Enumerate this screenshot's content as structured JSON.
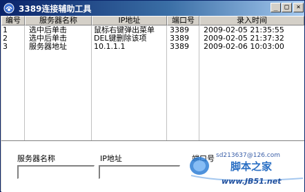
{
  "window": {
    "title": "3389连接辅助工具",
    "buttons": {
      "minimize": "_",
      "maximize": "□",
      "close": "×"
    }
  },
  "table": {
    "headers": [
      "编号",
      "服务器名称",
      "IP地址",
      "端口号",
      "录入时间"
    ],
    "rows": [
      [
        "1",
        "选中后单击",
        "鼠标右键弹出菜单",
        "3389",
        "2009-02-05 21:35:55"
      ],
      [
        "2",
        "选中后单击",
        "DEL键删除该项",
        "3389",
        "2009-02-05 21:37:32"
      ],
      [
        "3",
        "服务器地址",
        "10.1.1.1",
        "3389",
        "2009-02-06 10:03:00"
      ]
    ]
  },
  "form": {
    "server_name_label": "服务器名称",
    "ip_label": "IP地址",
    "port_label": "端口号",
    "server_name_value": "",
    "ip_value": ""
  },
  "watermark": {
    "email": "sd213637@126.com",
    "name": "脚本之家",
    "url": "www.JB51.net"
  },
  "colors": {
    "titlebar_start": "#0a246a",
    "titlebar_end": "#a6caf0",
    "window_face": "#d4d0c8",
    "watermark_blue": "#2a6fc4"
  }
}
